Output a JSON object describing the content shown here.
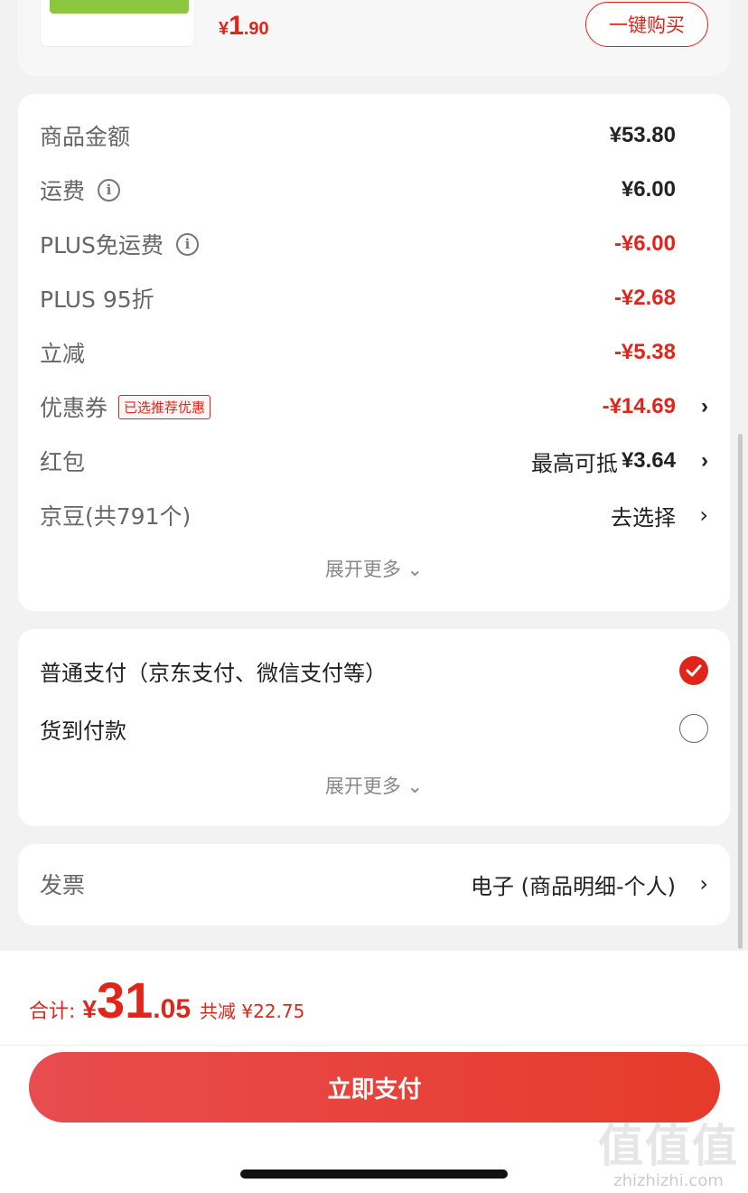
{
  "product": {
    "price_symbol": "¥",
    "price_integer": "1",
    "price_decimal": ".90",
    "buy_button": "一键购买"
  },
  "price_details": [
    {
      "label": "商品金额",
      "value": "¥53.80",
      "color": "#222222",
      "info": false,
      "chevron": false
    },
    {
      "label": "运费",
      "value": "¥6.00",
      "color": "#222222",
      "info": true,
      "chevron": false
    },
    {
      "label": "PLUS免运费",
      "value": "-¥6.00",
      "color": "#e1251b",
      "info": true,
      "chevron": false
    },
    {
      "label": "PLUS 95折",
      "value": "-¥2.68",
      "color": "#e1251b",
      "info": false,
      "chevron": false
    },
    {
      "label": "立减",
      "value": "-¥5.38",
      "color": "#e1251b",
      "info": false,
      "chevron": false
    },
    {
      "label": "优惠券",
      "badge": "已选推荐优惠",
      "value": "-¥14.69",
      "color": "#e1251b",
      "chevron": true
    },
    {
      "label": "红包",
      "value_prefix": "最高可抵",
      "value": "¥3.64",
      "color": "#222222",
      "chevron": true
    },
    {
      "label": "京豆(共791个)",
      "value": "去选择",
      "color": "#222222",
      "chevron": true
    }
  ],
  "price_expand": "展开更多 ⌄",
  "payment": {
    "options": [
      {
        "label": "普通支付（京东支付、微信支付等）",
        "selected": true
      },
      {
        "label": "货到付款",
        "selected": false
      }
    ],
    "expand": "展开更多 ⌄"
  },
  "invoice": {
    "label": "发票",
    "value": "电子 (商品明细-个人)"
  },
  "footer": {
    "total_label": "合计:",
    "total_symbol": "¥",
    "total_integer": "31",
    "total_decimal": ".05",
    "saved": "共减 ¥22.75",
    "pay_button": "立即支付"
  },
  "watermark": {
    "logo": "值值值",
    "site": "zhizhizhi.com"
  },
  "colors": {
    "accent": "#e1251b",
    "background": "#f2f2f2"
  }
}
